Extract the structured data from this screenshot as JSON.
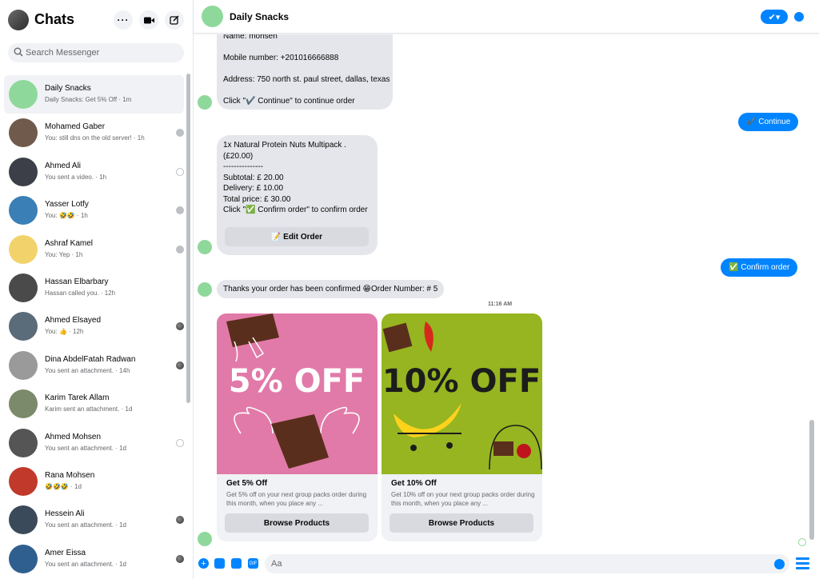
{
  "sidebar": {
    "title": "Chats",
    "search_placeholder": "Search Messenger",
    "header_icons": [
      "more-icon",
      "new-video-call-icon",
      "compose-icon"
    ],
    "chats": [
      {
        "name": "Daily Snacks",
        "preview": "Daily Snacks: Get 5% Off · 1m",
        "status": "none",
        "active": true,
        "avatar_color": "#8fd89b"
      },
      {
        "name": "Mohamed Gaber",
        "preview": "You: still dns on the old server! · 1h",
        "status": "filled",
        "avatar_color": "#6f5a4b"
      },
      {
        "name": "Ahmed Ali",
        "preview": "You sent a video. · 1h",
        "status": "outline",
        "avatar_color": "#3c3f48"
      },
      {
        "name": "Yasser Lotfy",
        "preview": "You: 🤣🤣 · 1h",
        "status": "filled",
        "avatar_color": "#3a7fb5"
      },
      {
        "name": "Ashraf Kamel",
        "preview": "You: Yep · 1h",
        "status": "filled",
        "avatar_color": "#f2d36b"
      },
      {
        "name": "Hassan Elbarbary",
        "preview": "Hassan called you. · 12h",
        "status": "none",
        "avatar_color": "#4a4a4a"
      },
      {
        "name": "Ahmed Elsayed",
        "preview": "You: 👍 · 12h",
        "status": "photo",
        "avatar_color": "#5a6b7a"
      },
      {
        "name": "Dina AbdelFatah Radwan",
        "preview": "You sent an attachment. · 14h",
        "status": "photo",
        "avatar_color": "#9a9a9a"
      },
      {
        "name": "Karim Tarek Allam",
        "preview": "Karim sent an attachment. · 1d",
        "status": "none",
        "avatar_color": "#7a8a6a"
      },
      {
        "name": "Ahmed Mohsen",
        "preview": "You sent an attachment. · 1d",
        "status": "outline",
        "avatar_color": "#555555"
      },
      {
        "name": "Rana Mohsen",
        "preview": "🤣🤣🤣 · 1d",
        "status": "none",
        "avatar_color": "#c0392b"
      },
      {
        "name": "Hessein Ali",
        "preview": "You sent an attachment. · 1d",
        "status": "photo",
        "avatar_color": "#3b4a5a"
      },
      {
        "name": "Amer Eissa",
        "preview": "You sent an attachment. · 1d",
        "status": "photo",
        "avatar_color": "#2f5f8f"
      }
    ]
  },
  "conversation": {
    "title": "Daily Snacks",
    "accent": "#0084ff",
    "bot_avatar_color": "#8fd89b",
    "msg1": {
      "line_name": "Name: mohsen",
      "line_mobile": "Mobile number: +201016666888",
      "line_address": "Address: 750 north st. paul street, dallas, texas",
      "line_click": "Click \"✔️ Continue\" to continue order"
    },
    "reply1": "✔️ Continue",
    "msg2": {
      "line1": "1x Natural Protein Nuts Multipack .",
      "line2": "(£20.00)",
      "line3": "---------------",
      "line4": "Subtotal: £ 20.00",
      "line5": "Delivery: £ 10.00",
      "line6": "Total price: £ 30.00",
      "line7": "Click \"✅ Confirm order\" to confirm order",
      "button": "📝 Edit Order"
    },
    "reply2": "✅ Confirm order",
    "msg3": "Thanks your order has been confirmed 😁Order Number: # 5",
    "timestamp": "11:16 AM",
    "cards": [
      {
        "banner": "5% OFF",
        "title": "Get 5% Off",
        "desc": "Get 5% off on your next group packs order during this month, when you place any ...",
        "button": "Browse Products",
        "bg": "#e17aa8"
      },
      {
        "banner": "10% OFF",
        "title": "Get 10% Off",
        "desc": "Get 10% off on your next group packs order during this month, when you place any ...",
        "button": "Browse Products",
        "bg": "#96b520"
      }
    ],
    "composer_placeholder": "Aa",
    "composer_icons": [
      "plus-icon",
      "image-icon",
      "sticker-icon",
      "gif-icon"
    ],
    "gif_label": "GIF"
  }
}
